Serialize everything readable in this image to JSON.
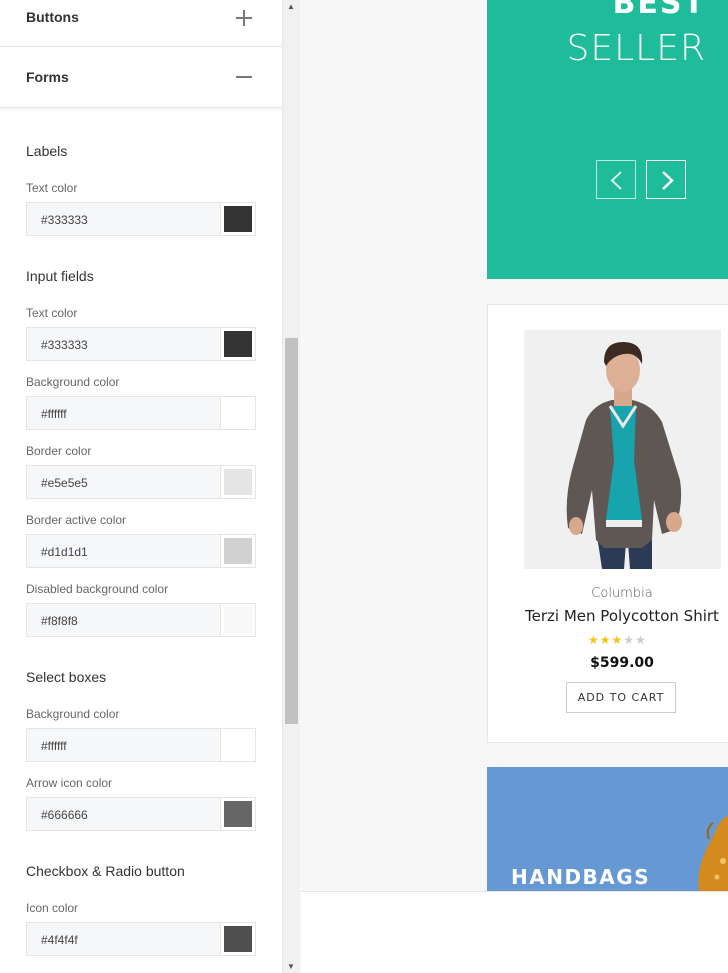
{
  "sidebar": {
    "accordion": [
      {
        "label": "Buttons",
        "state": "collapsed"
      },
      {
        "label": "Forms",
        "state": "expanded"
      }
    ],
    "sections": {
      "labels": {
        "title": "Labels",
        "text_color": {
          "label": "Text color",
          "value": "#333333"
        }
      },
      "input_fields": {
        "title": "Input fields",
        "text_color": {
          "label": "Text color",
          "value": "#333333"
        },
        "background_color": {
          "label": "Background color",
          "value": "#ffffff"
        },
        "border_color": {
          "label": "Border color",
          "value": "#e5e5e5"
        },
        "border_active_color": {
          "label": "Border active color",
          "value": "#d1d1d1"
        },
        "disabled_background_color": {
          "label": "Disabled background color",
          "value": "#f8f8f8"
        }
      },
      "select_boxes": {
        "title": "Select boxes",
        "background_color": {
          "label": "Background color",
          "value": "#ffffff"
        },
        "arrow_icon_color": {
          "label": "Arrow icon color",
          "value": "#666666"
        }
      },
      "checkbox_radio": {
        "title": "Checkbox & Radio button",
        "icon_color": {
          "label": "Icon color",
          "value": "#4f4f4f"
        }
      }
    }
  },
  "preview": {
    "banner": {
      "line1": "BEST",
      "line2": "SELLER",
      "color": "#1ebc9a"
    },
    "product": {
      "brand": "Columbia",
      "name": "Terzi Men Polycotton Shirt",
      "rating": 3,
      "rating_max": 5,
      "price": "$599.00",
      "add_to_cart": "ADD TO CART"
    },
    "collection": {
      "title": "HANDBAGS",
      "color": "#6699d3"
    }
  }
}
